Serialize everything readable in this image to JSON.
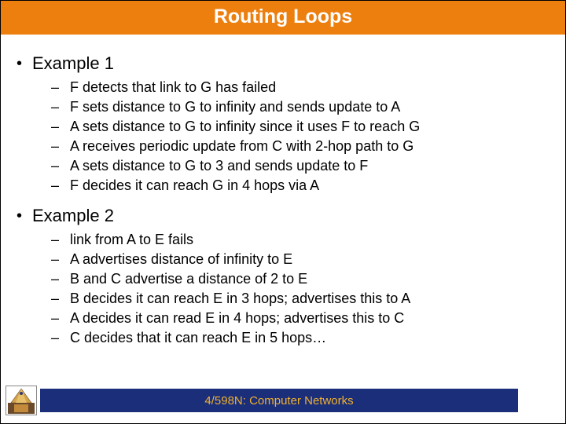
{
  "title": "Routing Loops",
  "bullets": [
    {
      "label": "Example 1",
      "items": [
        "F detects that link to G has failed",
        "F sets distance to G to infinity and sends update to A",
        "A sets distance to G to infinity since it uses F to reach G",
        "A receives periodic update from C with 2-hop path to G",
        "A sets distance to G to 3 and sends update to F",
        "F decides it can reach G in 4 hops via A"
      ]
    },
    {
      "label": "Example 2",
      "items": [
        "link from A to E fails",
        "A advertises distance of infinity to E",
        "B and C advertise a distance of 2 to E",
        "B decides it can reach E in 3 hops; advertises this to A",
        "A decides it can read E in 4 hops; advertises this to C",
        "C decides that it can reach E in 5 hops…"
      ]
    }
  ],
  "footer": "4/598N: Computer Networks",
  "glyphs": {
    "dot": "•",
    "dash": "–"
  }
}
